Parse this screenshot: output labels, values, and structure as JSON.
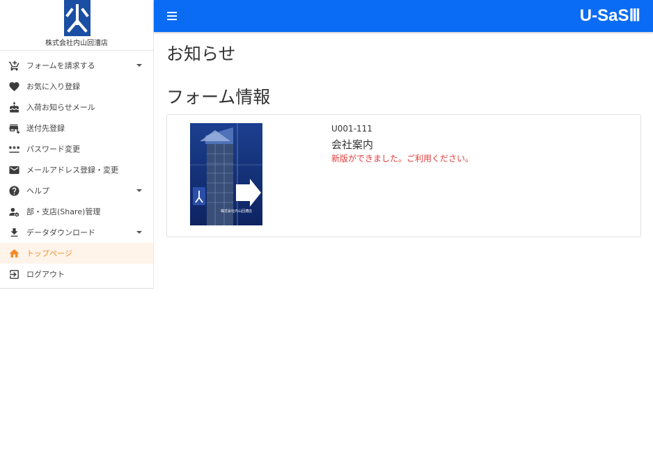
{
  "sidebar": {
    "company_name": "株式会社内山回漕店",
    "items": [
      {
        "label": "フォームを請求する",
        "icon": "cart-icon",
        "has_caret": true
      },
      {
        "label": "お気に入り登録",
        "icon": "heart-icon",
        "has_caret": false
      },
      {
        "label": "入荷お知らせメール",
        "icon": "cake-icon",
        "has_caret": false
      },
      {
        "label": "送付先登録",
        "icon": "store-plus-icon",
        "has_caret": false
      },
      {
        "label": "パスワード変更",
        "icon": "password-icon",
        "has_caret": false
      },
      {
        "label": "メールアドレス登録・変更",
        "icon": "mail-icon",
        "has_caret": false
      },
      {
        "label": "ヘルプ",
        "icon": "help-icon",
        "has_caret": true
      },
      {
        "label": "部・支店(Share)管理",
        "icon": "user-cog-icon",
        "has_caret": false
      },
      {
        "label": "データダウンロード",
        "icon": "download-icon",
        "has_caret": true
      },
      {
        "label": "トップページ",
        "icon": "home-icon",
        "has_caret": false,
        "active": true
      },
      {
        "label": "ログアウト",
        "icon": "logout-icon",
        "has_caret": false
      }
    ]
  },
  "header": {
    "app_title": "U-SaSⅢ"
  },
  "main": {
    "page_title": "お知らせ",
    "section_title": "フォーム情報",
    "form": {
      "code": "U001-111",
      "name": "会社案内",
      "notice": "新版ができました。ご利用ください。",
      "thumbnail_caption": "株式会社内山回漕店"
    }
  },
  "colors": {
    "topbar": "#0a6cf5",
    "active": "#f28c28",
    "notice": "#e43b3b",
    "brand": "#1a4fa3"
  }
}
